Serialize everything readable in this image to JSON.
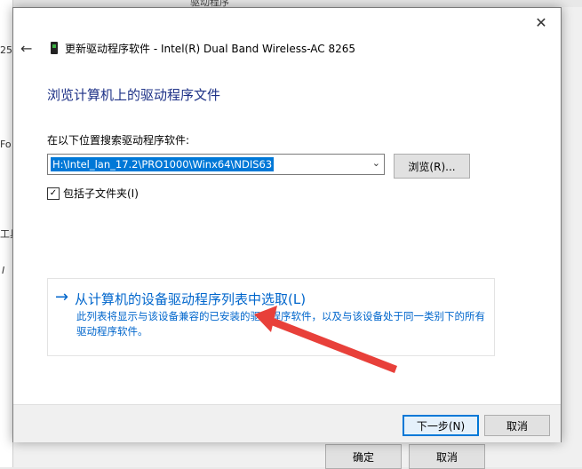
{
  "background": {
    "left_fragments": [
      "25-",
      "Fo",
      "工具",
      "I"
    ],
    "top_text": "驱动程序",
    "buttons": {
      "ok": "确定",
      "cancel": "取消"
    }
  },
  "dialog": {
    "title": "更新驱动程序软件 - Intel(R) Dual Band Wireless-AC 8265",
    "heading": "浏览计算机上的驱动程序文件",
    "search_label": "在以下位置搜索驱动程序软件:",
    "path_value": "H:\\Intel_lan_17.2\\PRO1000\\Winx64\\NDIS63",
    "browse_label": "浏览(R)...",
    "include_subfolders": {
      "label": "包括子文件夹(I)",
      "checked": true
    },
    "pick_option": {
      "title": "从计算机的设备驱动程序列表中选取(L)",
      "description": "此列表将显示与该设备兼容的已安装的驱动程序软件，以及与该设备处于同一类别下的所有驱动程序软件。"
    },
    "next_label": "下一步(N)",
    "cancel_label": "取消"
  },
  "icons": {
    "close": "close-icon",
    "back": "back-arrow-icon",
    "device": "network-adapter-icon",
    "chevron": "chevron-down-icon",
    "option_arrow": "arrow-right-icon"
  },
  "colors": {
    "heading": "#1e3287",
    "link": "#0066cc",
    "selection": "#0078d7",
    "annotation_arrow": "#e8403a"
  }
}
